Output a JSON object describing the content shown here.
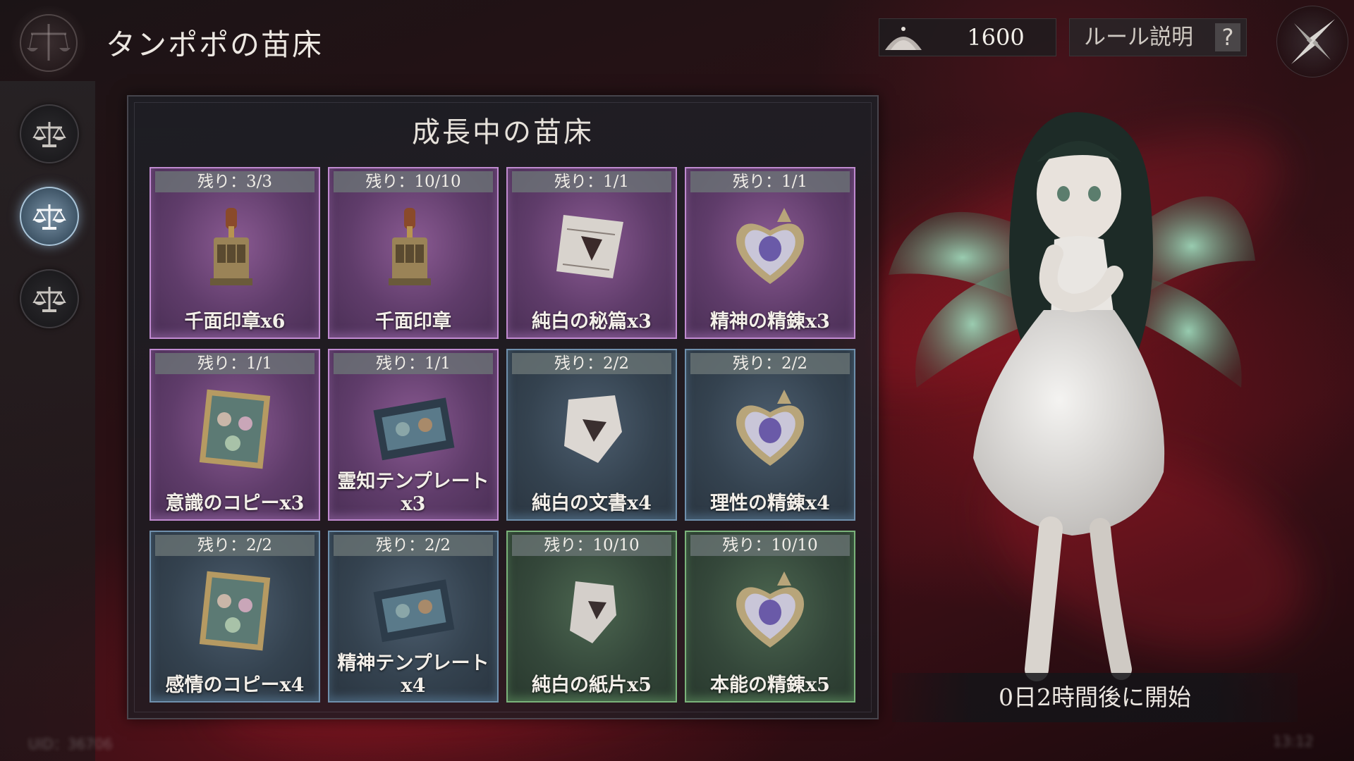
{
  "header": {
    "title": "タンポポの苗床"
  },
  "currency": {
    "amount": "1600",
    "icon": "sand-pile-icon"
  },
  "rules_button": {
    "label": "ルール説明",
    "icon_glyph": "?"
  },
  "sidebar": {
    "items": [
      {
        "icon": "scales-icon",
        "active": false
      },
      {
        "icon": "scales-icon",
        "active": true
      },
      {
        "icon": "scales-icon",
        "active": false
      }
    ]
  },
  "panel": {
    "title": "成長中の苗床"
  },
  "rewards": [
    {
      "remaining": "残り：3/3",
      "name": "千面印章x6",
      "rarity": "purple",
      "icon": "stamp-device-icon"
    },
    {
      "remaining": "残り：10/10",
      "name": "千面印章",
      "rarity": "purple",
      "icon": "stamp-device-icon"
    },
    {
      "remaining": "残り：1/1",
      "name": "純白の秘篇x3",
      "rarity": "purple",
      "icon": "scroll-icon"
    },
    {
      "remaining": "残り：1/1",
      "name": "精神の精錬x3",
      "rarity": "purple",
      "icon": "heart-crystal-icon"
    },
    {
      "remaining": "残り：1/1",
      "name": "意識のコピーx3",
      "rarity": "purple",
      "icon": "faces-frame-icon"
    },
    {
      "remaining": "残り：1/1",
      "name": "霊知テンプレートx3",
      "rarity": "purple",
      "icon": "film-strip-icon"
    },
    {
      "remaining": "残り：2/2",
      "name": "純白の文書x4",
      "rarity": "blue",
      "icon": "torn-paper-icon"
    },
    {
      "remaining": "残り：2/2",
      "name": "理性の精錬x4",
      "rarity": "blue",
      "icon": "heart-crystal-icon"
    },
    {
      "remaining": "残り：2/2",
      "name": "感情のコピーx4",
      "rarity": "blue",
      "icon": "faces-frame-icon"
    },
    {
      "remaining": "残り：2/2",
      "name": "精神テンプレートx4",
      "rarity": "blue",
      "icon": "film-strip-icon"
    },
    {
      "remaining": "残り：10/10",
      "name": "純白の紙片x5",
      "rarity": "green",
      "icon": "paper-scrap-icon"
    },
    {
      "remaining": "残り：10/10",
      "name": "本能の精錬x5",
      "rarity": "green",
      "icon": "heart-crystal-icon"
    }
  ],
  "countdown": {
    "text": "0日2時間後に開始"
  },
  "footer": {
    "uid": "UID：36706",
    "time": "13:12"
  },
  "colors": {
    "purple_border": "#c08ad0",
    "blue_border": "#6f90ad",
    "green_border": "#7ab37a",
    "active_side": "#a9c4d8"
  }
}
